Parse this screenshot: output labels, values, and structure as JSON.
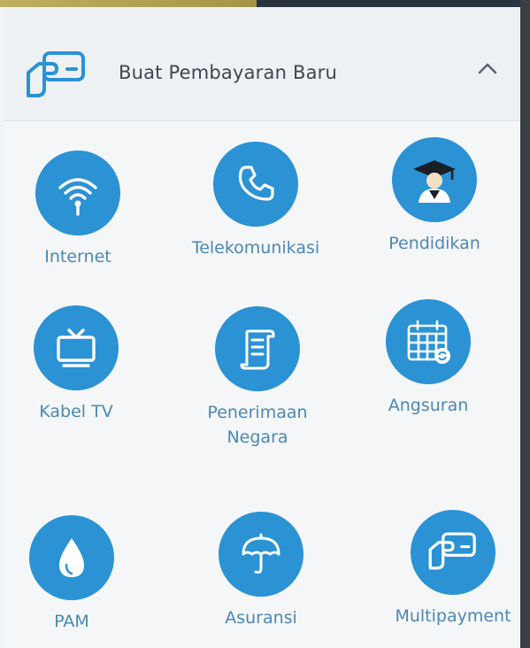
{
  "header": {
    "title": "Buat Pembayaran Baru",
    "icon": "card-payment-icon",
    "collapse_icon": "chevron-up-icon"
  },
  "items": [
    {
      "label": "Internet",
      "icon": "wifi-icon"
    },
    {
      "label": "Telekomunikasi",
      "icon": "phone-icon"
    },
    {
      "label": "Pendidikan",
      "icon": "graduate-icon"
    },
    {
      "label": "Kabel TV",
      "icon": "tv-icon"
    },
    {
      "label": "Penerimaan\nNegara",
      "icon": "scroll-document-icon"
    },
    {
      "label": "Angsuran",
      "icon": "calendar-refresh-icon"
    },
    {
      "label": "PAM",
      "icon": "water-drop-icon"
    },
    {
      "label": "Asuransi",
      "icon": "umbrella-icon"
    },
    {
      "label": "Multipayment",
      "icon": "card-payment-icon"
    }
  ],
  "colors": {
    "accent": "#2b92d4",
    "label": "#4c88b4",
    "title": "#3d4650"
  }
}
